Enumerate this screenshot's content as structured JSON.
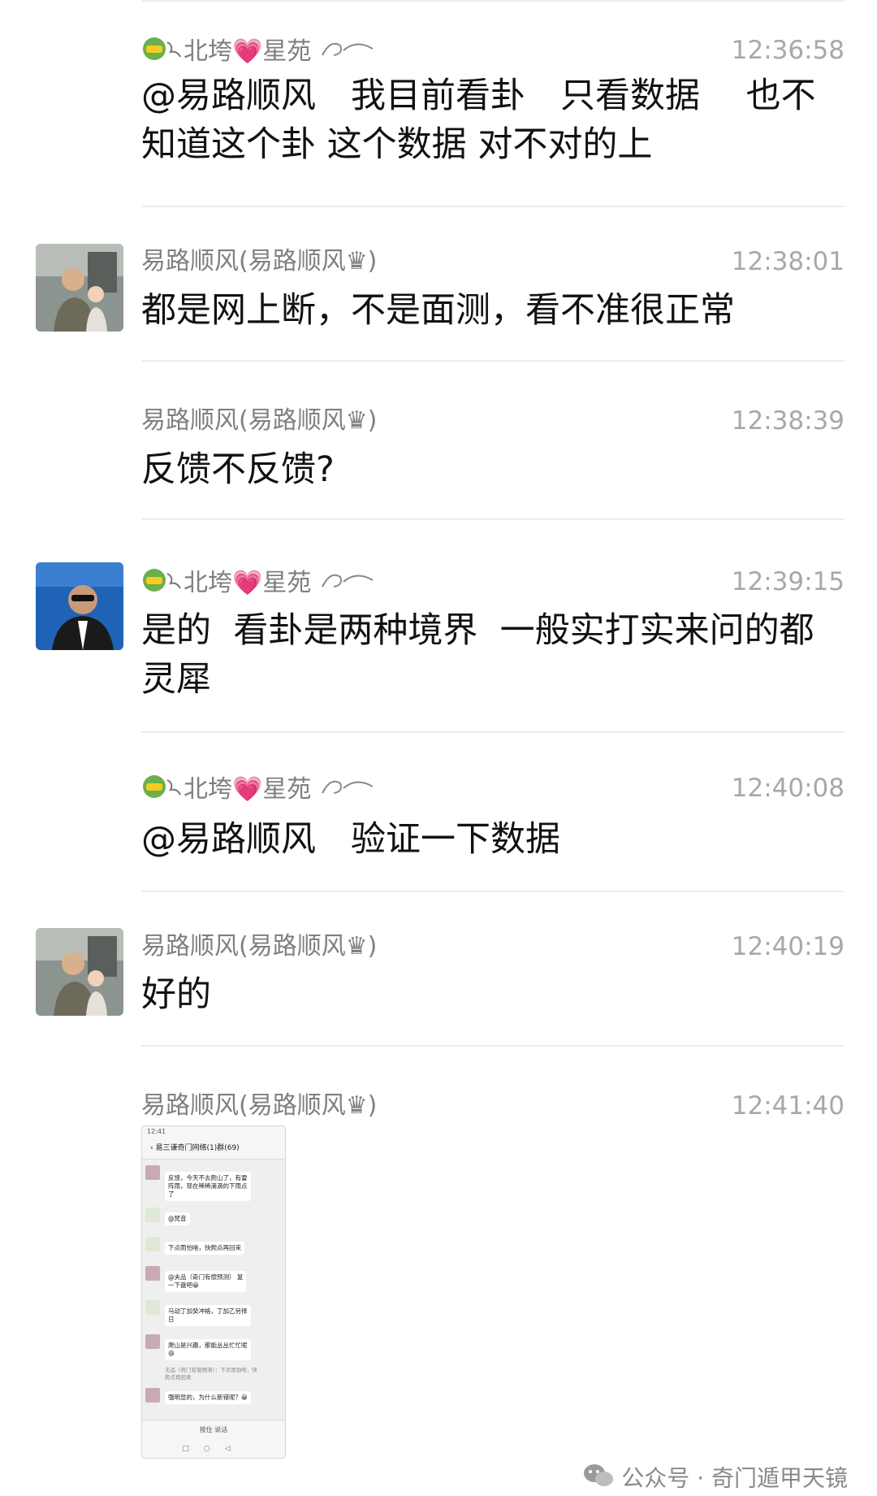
{
  "messages": [
    {
      "sender": "北垮💗星苑",
      "time": "12:36:58",
      "text": "@易路顺风　我目前看卦　只看数据　 也不知道这个卦 这个数据 对不对的上"
    },
    {
      "sender": "易路顺风(易路顺风♛)",
      "time": "12:38:01",
      "text": "都是网上断，不是面测，看不准很正常"
    },
    {
      "sender": "易路顺风(易路顺风♛)",
      "time": "12:38:39",
      "text": "反馈不反馈?"
    },
    {
      "sender": "北垮💗星苑",
      "time": "12:39:15",
      "text": "是的  看卦是两种境界  一般实打实来问的都灵犀"
    },
    {
      "sender": "北垮💗星苑",
      "time": "12:40:08",
      "text": "@易路顺风　验证一下数据"
    },
    {
      "sender": "易路顺风(易路顺风♛)",
      "time": "12:40:19",
      "text": "好的"
    },
    {
      "sender": "易路顺风(易路顺风♛)",
      "time": "12:41:40",
      "text": ""
    }
  ],
  "shared_image": {
    "title": "易三谦奇门网络(1)群(69)",
    "status_time": "12:41",
    "bubbles": [
      "反馈，今天不去爬山了，有雷\n阵雨，现在稀稀滴滴的下雨点\n了",
      "@梵音",
      "下点雨怕啥，快爬点再回来",
      "@夫品（奇门有偿预测） 复\n一下盘吧😀",
      "马动丁加癸冲格，丁加乙另择\n日",
      "爬山是兴趣，那能丛丛忙忙呢\n😄",
      "强明显的，为什么新错呢？😀"
    ],
    "system_note": "夫品（奇门有偿预测）：下点雨怕啥，快\n爬点再回来",
    "input_label": "按住 说话"
  },
  "watermark": "公众号 · 奇门遁甲天镜",
  "colors": {
    "background": "#ffffff",
    "name": "#7f7f7f",
    "time": "#a8a8a8",
    "text": "#111111",
    "divider": "#ececec"
  }
}
